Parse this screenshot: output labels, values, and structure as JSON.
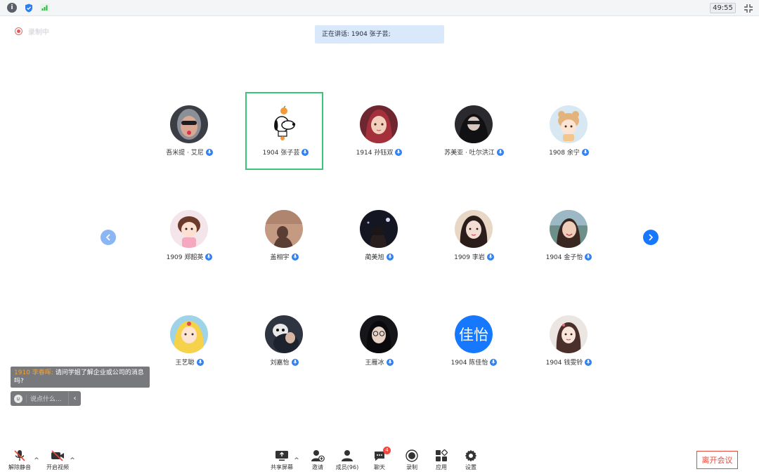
{
  "topbar": {
    "timer": "49:55",
    "icons": [
      "info-icon",
      "shield-icon",
      "signal-icon",
      "collapse-icon"
    ]
  },
  "recording": {
    "label": "录制中"
  },
  "speaking": {
    "text": "正在讲话: 1904 张子芸;"
  },
  "participants": [
    {
      "name": "吾米提 · 艾尼",
      "avatar": "photo"
    },
    {
      "name": "1904 张子芸",
      "avatar": "snoopy",
      "active": true
    },
    {
      "name": "1914 孙钰双",
      "avatar": "illustration"
    },
    {
      "name": "苏美亚 · 吐尔洪江",
      "avatar": "photo"
    },
    {
      "name": "1908 余宁",
      "avatar": "illustration"
    },
    {
      "name": "1909  郑韶英",
      "avatar": "illustration"
    },
    {
      "name": "盖相宇",
      "avatar": "photo"
    },
    {
      "name": "蔺美旭",
      "avatar": "photo"
    },
    {
      "name": "1909 李岩",
      "avatar": "photo"
    },
    {
      "name": "1904 金子怡",
      "avatar": "photo"
    },
    {
      "name": "王艺聪",
      "avatar": "illustration"
    },
    {
      "name": "刘嘉怡",
      "avatar": "photo"
    },
    {
      "name": "王雁冰",
      "avatar": "photo"
    },
    {
      "name": "1904  陈佳怡",
      "avatar": "text",
      "avatar_text": "佳怡"
    },
    {
      "name": "1904 钱雯铃",
      "avatar": "illustration"
    }
  ],
  "chat": {
    "sender": "1910 李春晖:",
    "message": "请问学姐了解企业或公司的消息吗?",
    "placeholder": "说点什么...",
    "collapse_icon": "chevron-left-icon"
  },
  "toolbar": {
    "unmute": "解除静音",
    "start_video": "开启视频",
    "share_screen": "共享屏幕",
    "invite": "邀请",
    "members": "成员(96)",
    "chat": "聊天",
    "chat_badge": "4",
    "record": "录制",
    "apps": "应用",
    "settings": "设置",
    "leave": "离开会议"
  },
  "colors": {
    "accent": "#1677ff",
    "active_border": "#3cc47a",
    "leave": "#e8493b",
    "banner": "#dae8fb"
  }
}
